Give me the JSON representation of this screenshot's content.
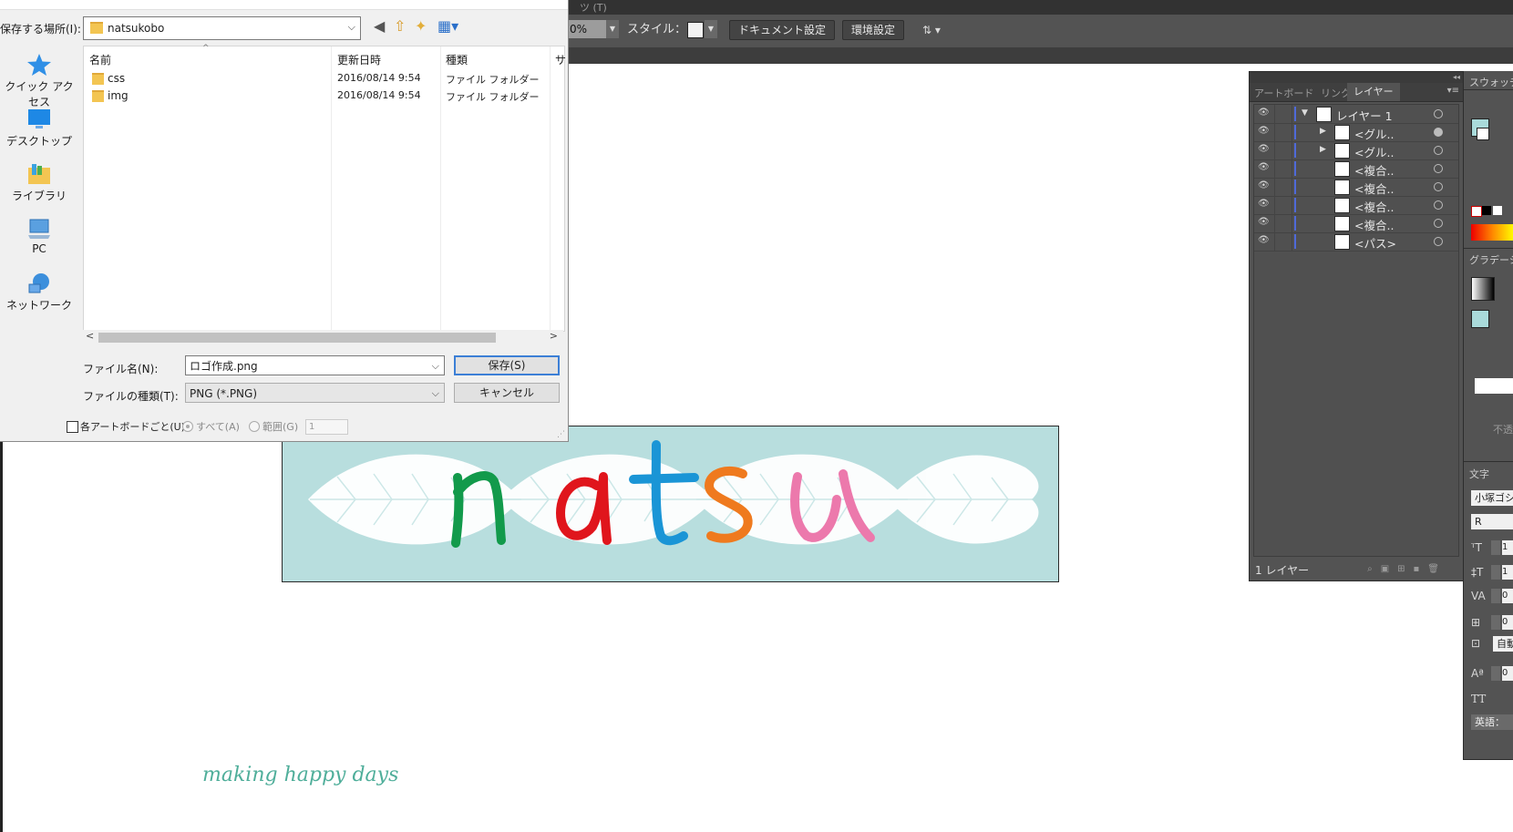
{
  "illustrator": {
    "control_bar": {
      "opacity_value": "0%",
      "style_label": "スタイル：",
      "doc_settings_button": "ドキュメント設定",
      "prefs_button": "環境設定"
    },
    "topbar_ghost_text": "ツ (T)"
  },
  "dialog": {
    "location_label": "保存する場所(I):",
    "location_value": "natsukobo",
    "places": [
      {
        "label": "クイック アクセス",
        "icon": "star-icon"
      },
      {
        "label": "デスクトップ",
        "icon": "desktop-icon"
      },
      {
        "label": "ライブラリ",
        "icon": "library-icon"
      },
      {
        "label": "PC",
        "icon": "pc-icon"
      },
      {
        "label": "ネットワーク",
        "icon": "network-icon"
      }
    ],
    "columns": [
      "名前",
      "更新日時",
      "種類",
      "サ"
    ],
    "files": [
      {
        "name": "css",
        "date": "2016/08/14 9:54",
        "type": "ファイル フォルダー"
      },
      {
        "name": "img",
        "date": "2016/08/14 9:54",
        "type": "ファイル フォルダー"
      }
    ],
    "filename_label": "ファイル名(N):",
    "filename_value": "ロゴ作成.png",
    "filetype_label": "ファイルの種類(T):",
    "filetype_value": "PNG (*.PNG)",
    "save_button": "保存(S)",
    "cancel_button": "キャンセル",
    "artboard_checkbox": "各アートボードごと(U)",
    "all_radio": "すべて(A)",
    "range_radio": "範囲(G)",
    "range_value": "1"
  },
  "layers_panel": {
    "tabs": [
      "アートボード",
      "リンク",
      "レイヤー"
    ],
    "active_tab": "レイヤー",
    "layers": [
      {
        "name": "レイヤー 1",
        "expanded": true,
        "target_filled": false
      },
      {
        "name": "<グル..",
        "expanded": false,
        "target_filled": true
      },
      {
        "name": "<グル..",
        "expanded": false,
        "target_filled": false
      },
      {
        "name": "<複合..",
        "expanded": null,
        "target_filled": false
      },
      {
        "name": "<複合..",
        "expanded": null,
        "target_filled": false
      },
      {
        "name": "<複合..",
        "expanded": null,
        "target_filled": false
      },
      {
        "name": "<複合..",
        "expanded": null,
        "target_filled": false
      },
      {
        "name": "<パス>",
        "expanded": null,
        "target_filled": false
      }
    ],
    "footer_count": "1 レイヤー",
    "layer_color": "#4f6ad9"
  },
  "dock": {
    "swatches_title": "スウォッチ",
    "gradient_title": "グラデーシ",
    "opacity_title": "不透",
    "character_title": "文字",
    "font_family": "小塚ゴシ",
    "font_style": "R",
    "language": "英語：",
    "auto_label": "自動",
    "tt_label": "TT"
  },
  "artwork": {
    "logo_letters": [
      {
        "char": "n",
        "color": "#129a4b"
      },
      {
        "char": "a",
        "color": "#e0151c"
      },
      {
        "char": "t",
        "color": "#1a95d6"
      },
      {
        "char": "s",
        "color": "#ef7a1e"
      },
      {
        "char": "u",
        "color": "#ec79ac"
      }
    ],
    "board_color": "#b8dede",
    "tagline": "making happy days",
    "tagline_color": "#4fae9a"
  }
}
